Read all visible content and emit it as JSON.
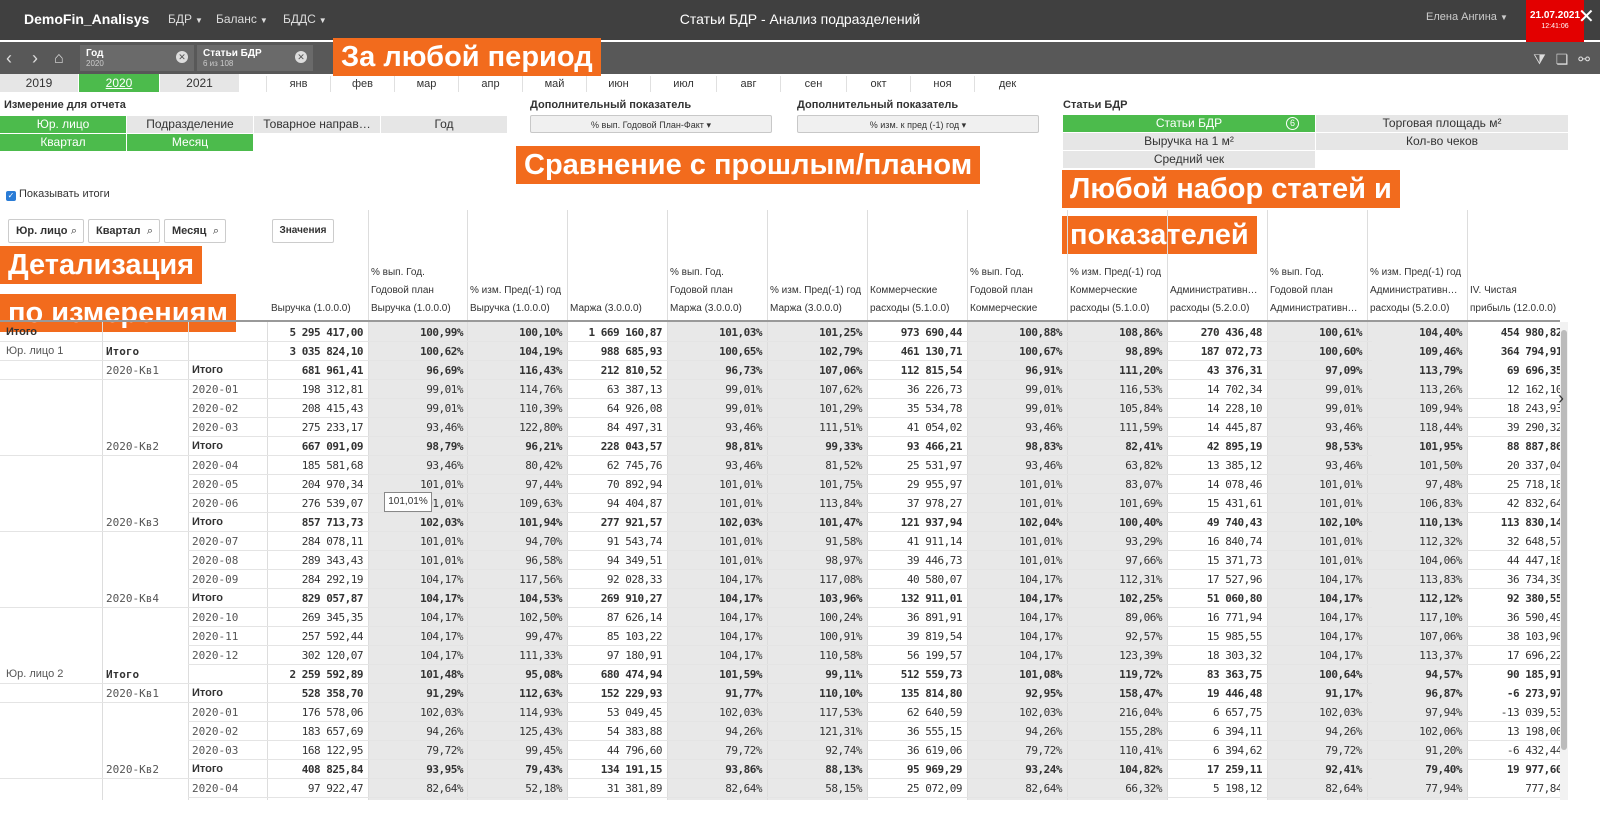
{
  "topbar": {
    "app_name": "DemoFin_Analisys",
    "menus": [
      "БДР",
      "Баланс",
      "БДДС"
    ],
    "title": "Статьи БДР - Анализ подразделений",
    "user": "Елена Ангина",
    "date": "21.07.2021",
    "time": "12:41:06"
  },
  "selections": [
    {
      "name": "Год",
      "value": "2020"
    },
    {
      "name": "Статьи БДР",
      "value": "6 из 108"
    }
  ],
  "banners": {
    "period": "За любой период",
    "compare": "Сравнение с прошлым/планом",
    "articles_1": "Любой набор статей и",
    "articles_2": "показателей",
    "detail_1": "Детализация",
    "detail_2": "по измерениям"
  },
  "years": [
    "2019",
    "2020",
    "2021"
  ],
  "months": [
    "янв",
    "фев",
    "мар",
    "апр",
    "май",
    "июн",
    "июл",
    "авг",
    "сен",
    "окт",
    "ноя",
    "дек"
  ],
  "dimension": {
    "label": "Измерение для отчета",
    "buttons": [
      "Юр. лицо",
      "Подразделение",
      "Товарное направ…",
      "Год",
      "Квартал",
      "Месяц"
    ]
  },
  "extra1": {
    "label": "Дополнительный показатель",
    "value": "% вып. Годовой План-Факт"
  },
  "extra2": {
    "label": "Дополнительный показатель",
    "value": "% изм. к пред (-1) год"
  },
  "articles": {
    "label": "Статьи БДР",
    "items": [
      "Статьи БДР",
      "Торговая площадь м²",
      "Выручка на 1 м²",
      "Кол-во чеков",
      "Средний чек"
    ],
    "count": "6"
  },
  "show_totals": "Показывать итоги",
  "filters": [
    "Юр. лицо",
    "Квартал",
    "Месяц"
  ],
  "values_button": "Значения",
  "columns": [
    "Выручка (1.0.0.0)",
    "% вып. Год.\nГодовой план\nВыручка (1.0.0.0)",
    "% изм. Пред(-1) год\nВыручка (1.0.0.0)",
    "Маржа (3.0.0.0)",
    "% вып. Год.\nГодовой план\nМаржа (3.0.0.0)",
    "% изм. Пред(-1) год\nМаржа (3.0.0.0)",
    "Коммерческие\nрасходы (5.1.0.0)",
    "% вып. Год.\nГодовой план\nКоммерческие",
    "% изм. Пред(-1) год\nКоммерческие\nрасходы (5.1.0.0)",
    "Административн…\nрасходы (5.2.0.0)",
    "% вып. Год.\nГодовой план\nАдминистративн…",
    "% изм. Пред(-1) год\nАдминистративн…\nрасходы (5.2.0.0)",
    "IV. Чистая\nприбыль (12.0.0.0)"
  ],
  "rows": [
    {
      "d1": "Итого",
      "d2": "",
      "d3": "",
      "total": true,
      "v": [
        "5 295 417,00",
        "100,99%",
        "100,10%",
        "1 669 160,87",
        "101,03%",
        "101,25%",
        "973 690,44",
        "100,88%",
        "108,86%",
        "270 436,48",
        "100,61%",
        "104,40%",
        "454 980,82"
      ]
    },
    {
      "d1": "Юр. лицо 1",
      "d2": "Итого",
      "d3": "",
      "total": true,
      "v": [
        "3 035 824,10",
        "100,62%",
        "104,19%",
        "988 685,93",
        "100,65%",
        "102,79%",
        "461 130,71",
        "100,67%",
        "98,89%",
        "187 072,73",
        "100,60%",
        "109,46%",
        "364 794,91"
      ]
    },
    {
      "d1": "",
      "d2": "2020-Кв1",
      "d3": "Итого",
      "total": true,
      "v": [
        "681 961,41",
        "96,69%",
        "116,43%",
        "212 810,52",
        "96,73%",
        "107,06%",
        "112 815,54",
        "96,91%",
        "111,20%",
        "43 376,31",
        "97,09%",
        "113,79%",
        "69 696,35"
      ]
    },
    {
      "d1": "",
      "d2": "",
      "d3": "2020-01",
      "total": false,
      "v": [
        "198 312,81",
        "99,01%",
        "114,76%",
        "63 387,13",
        "99,01%",
        "107,62%",
        "36 226,73",
        "99,01%",
        "116,53%",
        "14 702,34",
        "99,01%",
        "113,26%",
        "12 162,10"
      ]
    },
    {
      "d1": "",
      "d2": "",
      "d3": "2020-02",
      "total": false,
      "v": [
        "208 415,43",
        "99,01%",
        "110,39%",
        "64 926,08",
        "99,01%",
        "101,29%",
        "35 534,78",
        "99,01%",
        "105,84%",
        "14 228,10",
        "99,01%",
        "109,94%",
        "18 243,93"
      ]
    },
    {
      "d1": "",
      "d2": "",
      "d3": "2020-03",
      "total": false,
      "v": [
        "275 233,17",
        "93,46%",
        "122,80%",
        "84 497,31",
        "93,46%",
        "111,51%",
        "41 054,02",
        "93,46%",
        "111,59%",
        "14 445,87",
        "93,46%",
        "118,44%",
        "39 290,32"
      ]
    },
    {
      "d1": "",
      "d2": "2020-Кв2",
      "d3": "Итого",
      "total": true,
      "v": [
        "667 091,09",
        "98,79%",
        "96,21%",
        "228 043,57",
        "98,81%",
        "99,33%",
        "93 466,21",
        "98,83%",
        "82,41%",
        "42 895,19",
        "98,53%",
        "101,95%",
        "88 887,86"
      ]
    },
    {
      "d1": "",
      "d2": "",
      "d3": "2020-04",
      "total": false,
      "v": [
        "185 581,68",
        "93,46%",
        "80,42%",
        "62 745,76",
        "93,46%",
        "81,52%",
        "25 531,97",
        "93,46%",
        "63,82%",
        "13 385,12",
        "93,46%",
        "101,50%",
        "20 337,04"
      ]
    },
    {
      "d1": "",
      "d2": "",
      "d3": "2020-05",
      "total": false,
      "v": [
        "204 970,34",
        "101,01%",
        "97,44%",
        "70 892,94",
        "101,01%",
        "101,75%",
        "29 955,97",
        "101,01%",
        "83,07%",
        "14 078,46",
        "101,01%",
        "97,48%",
        "25 718,18"
      ]
    },
    {
      "d1": "",
      "d2": "",
      "d3": "2020-06",
      "total": false,
      "v": [
        "276 539,07",
        "101,01%",
        "109,63%",
        "94 404,87",
        "101,01%",
        "113,84%",
        "37 978,27",
        "101,01%",
        "101,69%",
        "15 431,61",
        "101,01%",
        "106,83%",
        "42 832,64"
      ]
    },
    {
      "d1": "",
      "d2": "2020-Кв3",
      "d3": "Итого",
      "total": true,
      "v": [
        "857 713,73",
        "102,03%",
        "101,94%",
        "277 921,57",
        "102,03%",
        "101,47%",
        "121 937,94",
        "102,04%",
        "100,40%",
        "49 740,43",
        "102,10%",
        "110,13%",
        "113 830,14"
      ]
    },
    {
      "d1": "",
      "d2": "",
      "d3": "2020-07",
      "total": false,
      "v": [
        "284 078,11",
        "101,01%",
        "94,70%",
        "91 543,74",
        "101,01%",
        "91,58%",
        "41 911,14",
        "101,01%",
        "93,29%",
        "16 840,74",
        "101,01%",
        "112,32%",
        "32 648,57"
      ]
    },
    {
      "d1": "",
      "d2": "",
      "d3": "2020-08",
      "total": false,
      "v": [
        "289 343,43",
        "101,01%",
        "96,58%",
        "94 349,51",
        "101,01%",
        "98,97%",
        "39 446,73",
        "101,01%",
        "97,66%",
        "15 371,73",
        "101,01%",
        "104,06%",
        "44 447,18"
      ]
    },
    {
      "d1": "",
      "d2": "",
      "d3": "2020-09",
      "total": false,
      "v": [
        "284 292,19",
        "104,17%",
        "117,56%",
        "92 028,33",
        "104,17%",
        "117,08%",
        "40 580,07",
        "104,17%",
        "112,31%",
        "17 527,96",
        "104,17%",
        "113,83%",
        "36 734,39"
      ]
    },
    {
      "d1": "",
      "d2": "2020-Кв4",
      "d3": "Итого",
      "total": true,
      "v": [
        "829 057,87",
        "104,17%",
        "104,53%",
        "269 910,27",
        "104,17%",
        "103,96%",
        "132 911,01",
        "104,17%",
        "102,25%",
        "51 060,80",
        "104,17%",
        "112,12%",
        "92 380,55"
      ]
    },
    {
      "d1": "",
      "d2": "",
      "d3": "2020-10",
      "total": false,
      "v": [
        "269 345,35",
        "104,17%",
        "102,50%",
        "87 626,14",
        "104,17%",
        "100,24%",
        "36 891,91",
        "104,17%",
        "89,06%",
        "16 771,94",
        "104,17%",
        "117,10%",
        "36 590,49"
      ]
    },
    {
      "d1": "",
      "d2": "",
      "d3": "2020-11",
      "total": false,
      "v": [
        "257 592,44",
        "104,17%",
        "99,47%",
        "85 103,22",
        "104,17%",
        "100,91%",
        "39 819,54",
        "104,17%",
        "92,57%",
        "15 985,55",
        "104,17%",
        "107,06%",
        "38 103,90"
      ]
    },
    {
      "d1": "",
      "d2": "",
      "d3": "2020-12",
      "total": false,
      "v": [
        "302 120,07",
        "104,17%",
        "111,33%",
        "97 180,91",
        "104,17%",
        "110,58%",
        "56 199,57",
        "104,17%",
        "123,39%",
        "18 303,32",
        "104,17%",
        "113,37%",
        "17 696,22"
      ]
    },
    {
      "d1": "Юр. лицо 2",
      "d2": "Итого",
      "d3": "",
      "total": true,
      "v": [
        "2 259 592,89",
        "101,48%",
        "95,08%",
        "680 474,94",
        "101,59%",
        "99,11%",
        "512 559,73",
        "101,08%",
        "119,72%",
        "83 363,75",
        "100,64%",
        "94,57%",
        "90 185,91"
      ]
    },
    {
      "d1": "",
      "d2": "2020-Кв1",
      "d3": "Итого",
      "total": true,
      "v": [
        "528 358,70",
        "91,29%",
        "112,63%",
        "152 229,93",
        "91,77%",
        "110,10%",
        "135 814,80",
        "92,95%",
        "158,47%",
        "19 446,48",
        "91,17%",
        "96,87%",
        "-6 273,97"
      ]
    },
    {
      "d1": "",
      "d2": "",
      "d3": "2020-01",
      "total": false,
      "v": [
        "176 578,06",
        "102,03%",
        "114,93%",
        "53 049,45",
        "102,03%",
        "117,53%",
        "62 640,59",
        "102,03%",
        "216,04%",
        "6 657,75",
        "102,03%",
        "97,94%",
        "-13 039,53"
      ]
    },
    {
      "d1": "",
      "d2": "",
      "d3": "2020-02",
      "total": false,
      "v": [
        "183 657,69",
        "94,26%",
        "125,43%",
        "54 383,88",
        "94,26%",
        "121,31%",
        "36 555,15",
        "94,26%",
        "155,28%",
        "6 394,11",
        "94,26%",
        "102,06%",
        "13 198,00"
      ]
    },
    {
      "d1": "",
      "d2": "",
      "d3": "2020-03",
      "total": false,
      "v": [
        "168 122,95",
        "79,72%",
        "99,45%",
        "44 796,60",
        "79,72%",
        "92,74%",
        "36 619,06",
        "79,72%",
        "110,41%",
        "6 394,62",
        "79,72%",
        "91,20%",
        "-6 432,44"
      ]
    },
    {
      "d1": "",
      "d2": "2020-Кв2",
      "d3": "Итого",
      "total": true,
      "v": [
        "408 825,84",
        "93,95%",
        "79,43%",
        "134 191,15",
        "93,86%",
        "88,13%",
        "95 969,29",
        "93,24%",
        "104,82%",
        "17 259,11",
        "92,41%",
        "79,40%",
        "19 977,60"
      ]
    },
    {
      "d1": "",
      "d2": "",
      "d3": "2020-04",
      "total": false,
      "v": [
        "97 922,47",
        "82,64%",
        "52,18%",
        "31 381,89",
        "82,64%",
        "58,15%",
        "25 072,09",
        "82,64%",
        "66,32%",
        "5 198,12",
        "82,64%",
        "77,94%",
        "777,84"
      ]
    }
  ],
  "tooltip": "101,01%"
}
